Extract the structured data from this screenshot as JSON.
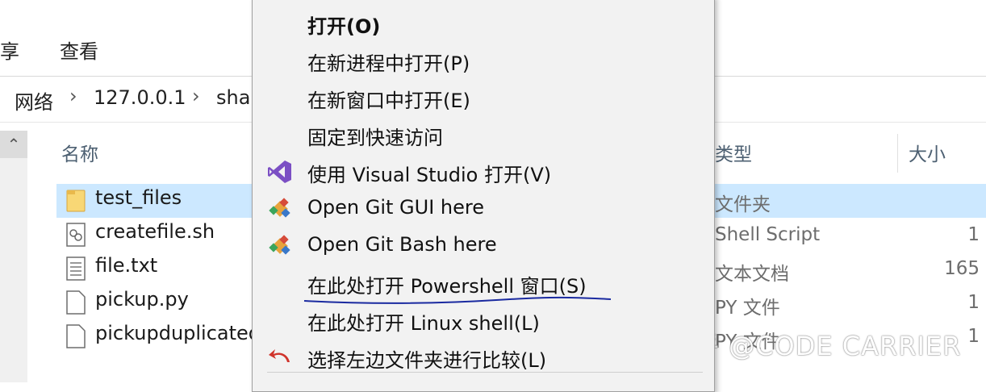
{
  "ribbon": {
    "tabs": [
      "享",
      "查看"
    ]
  },
  "address": {
    "crumbs": [
      "网络",
      "127.0.0.1",
      "sha"
    ]
  },
  "columns": {
    "name": "名称",
    "type": "类型",
    "size": "大小"
  },
  "files": [
    {
      "name": "test_files",
      "type": "文件夹",
      "size": "",
      "icon": "folder-icon"
    },
    {
      "name": "createfile.sh",
      "type": "Shell Script",
      "size": "1",
      "icon": "script-file-icon"
    },
    {
      "name": "file.txt",
      "type": "文本文档",
      "size": "165",
      "icon": "text-file-icon"
    },
    {
      "name": "pickup.py",
      "type": "PY 文件",
      "size": "1",
      "icon": "blank-file-icon"
    },
    {
      "name": "pickupduplicated",
      "type": "PY 文件",
      "size": "1",
      "icon": "blank-file-icon"
    }
  ],
  "context_menu": {
    "items": [
      {
        "label": "打开(O)",
        "bold": true,
        "icon": ""
      },
      {
        "label": "在新进程中打开(P)",
        "icon": ""
      },
      {
        "label": "在新窗口中打开(E)",
        "icon": ""
      },
      {
        "label": "固定到快速访问",
        "icon": ""
      },
      {
        "label": "使用 Visual Studio 打开(V)",
        "icon": "visual-studio-icon"
      },
      {
        "label": "Open Git GUI here",
        "icon": "git-gui-icon"
      },
      {
        "label": "Open Git Bash here",
        "icon": "git-bash-icon"
      },
      {
        "label": "在此处打开 Powershell 窗口(S)",
        "icon": ""
      },
      {
        "label": "在此处打开 Linux shell(L)",
        "icon": ""
      },
      {
        "label": "选择左边文件夹进行比较(L)",
        "icon": "compare-icon"
      }
    ]
  },
  "watermark": "知乎 @CODE CARRIER",
  "colors": {
    "selection": "#cce8ff",
    "annotation_underline": "#1a2aa0",
    "vs_purple": "#7b4fc4"
  }
}
